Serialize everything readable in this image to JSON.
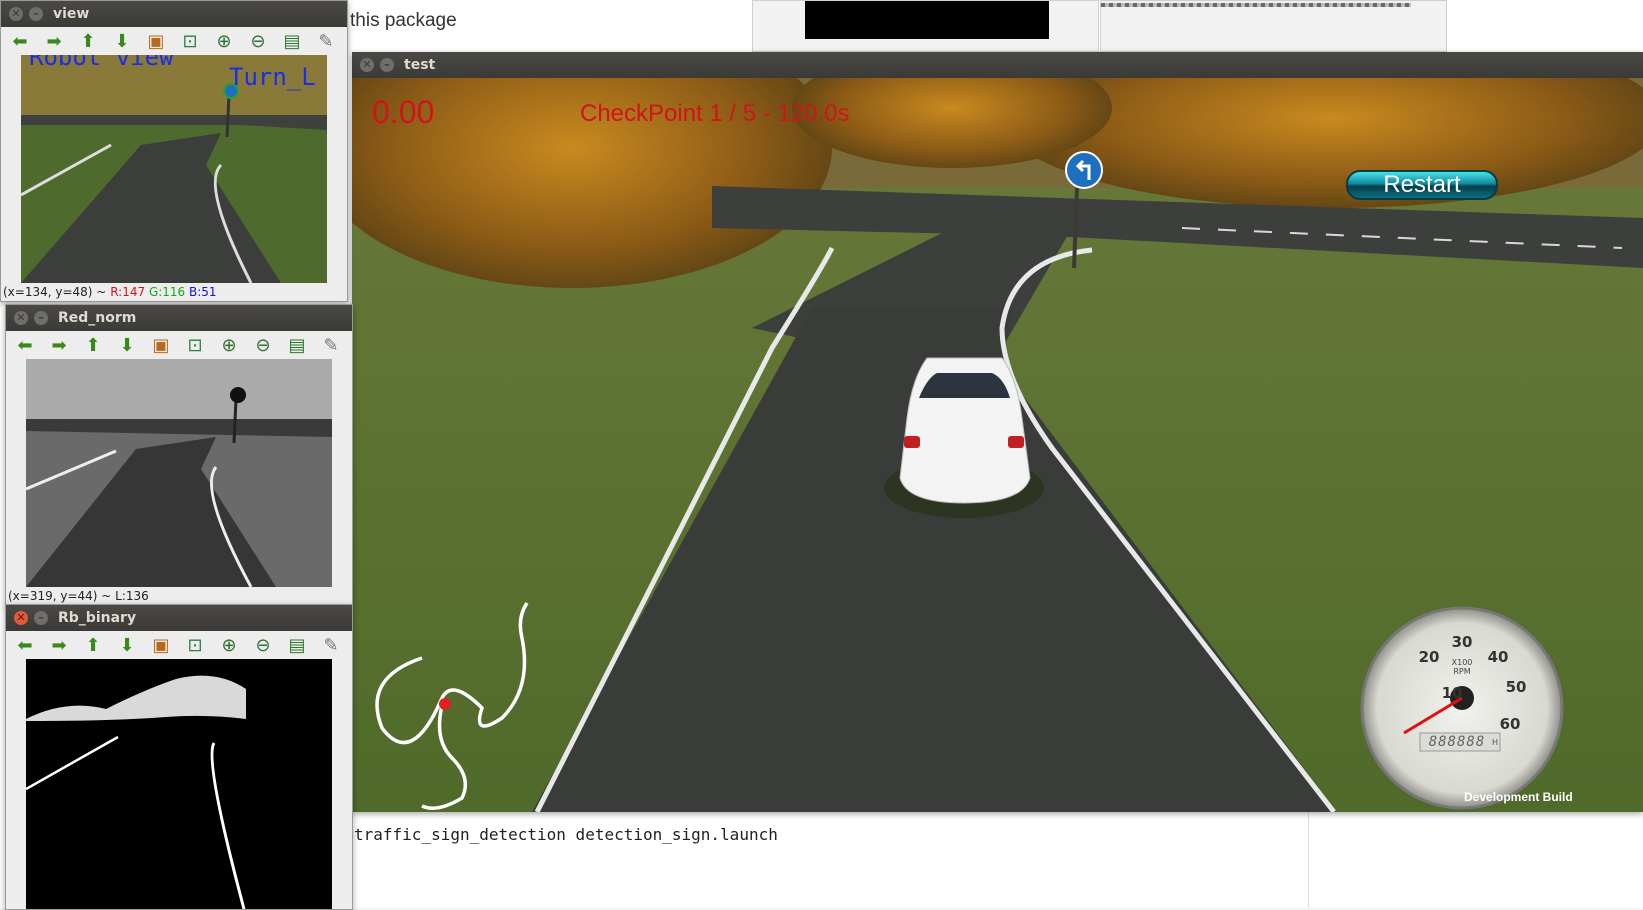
{
  "background_doc": {
    "top_text": "this package",
    "cmd_text": "traffic_sign_detection detection_sign.launch"
  },
  "view_window": {
    "title": "view",
    "overlay_text": "Robot view",
    "overlay_text2": "Turn_L",
    "status": {
      "coords": "(x=134, y=48) ~",
      "r": "R:147",
      "g": "G:116",
      "b": "B:51"
    }
  },
  "red_norm_window": {
    "title": "Red_norm",
    "status": "(x=319, y=44) ~ L:136"
  },
  "rb_binary_window": {
    "title": "Rb_binary"
  },
  "toolbar_icons": [
    "arrow-left-icon",
    "arrow-right-icon",
    "arrow-up-icon",
    "arrow-down-icon",
    "image-icon",
    "zoom-fit-icon",
    "zoom-in-icon",
    "zoom-out-icon",
    "save-icon",
    "clear-icon"
  ],
  "test_window": {
    "title": "test",
    "speed": "0.00",
    "checkpoint": "CheckPoint 1 / 5 - 120.0s",
    "restart_label": "Restart",
    "tach": {
      "ticks": [
        "10",
        "20",
        "30",
        "40",
        "50",
        "60"
      ],
      "unit": "X100\nRPM",
      "digital": "888888",
      "digital_unit": "H"
    },
    "watermark": "Development Build"
  },
  "colors": {
    "hud_red": "#d0141a",
    "restart_cyan": "#1fb9c9",
    "sign_blue": "#1f6fc0",
    "title_bar": "#3f3e3b",
    "close_red": "#e2583a"
  }
}
